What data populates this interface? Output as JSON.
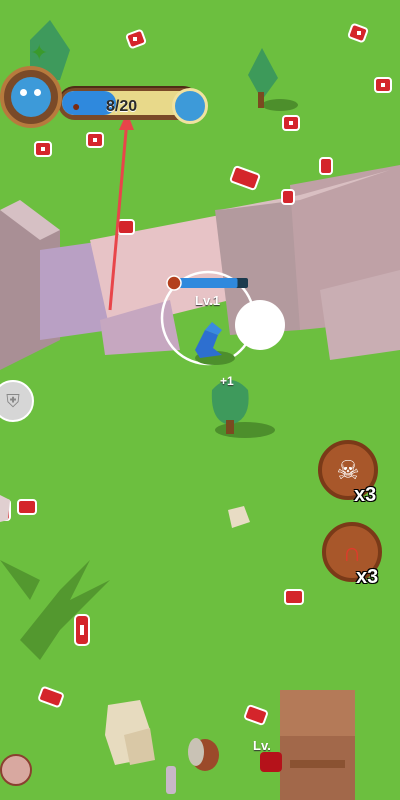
{
  "hud": {
    "progress_text": "8/20",
    "progress_value": 8,
    "progress_max": 20,
    "meat_icon": "meat-icon",
    "avatar_icon": "blue-dino-icon",
    "next_icon": "blue-dino-next-icon"
  },
  "player": {
    "level_label": "Lv.1",
    "gain_label": "+1",
    "level_progress": 0.85
  },
  "enemy": {
    "level_label": "Lv."
  },
  "skills": [
    {
      "name": "dino-rage-skill",
      "icon": "dino-roar-icon",
      "count_label": "x3"
    },
    {
      "name": "magnet-skill",
      "icon": "magnet-icon",
      "count_label": "x3"
    }
  ],
  "colors": {
    "grass": "#6cbf3f",
    "meat": "#d4252b",
    "rock": "#c9a8ae",
    "progress_fill": "#2f89dd",
    "hud_frame": "#7a4a28"
  }
}
